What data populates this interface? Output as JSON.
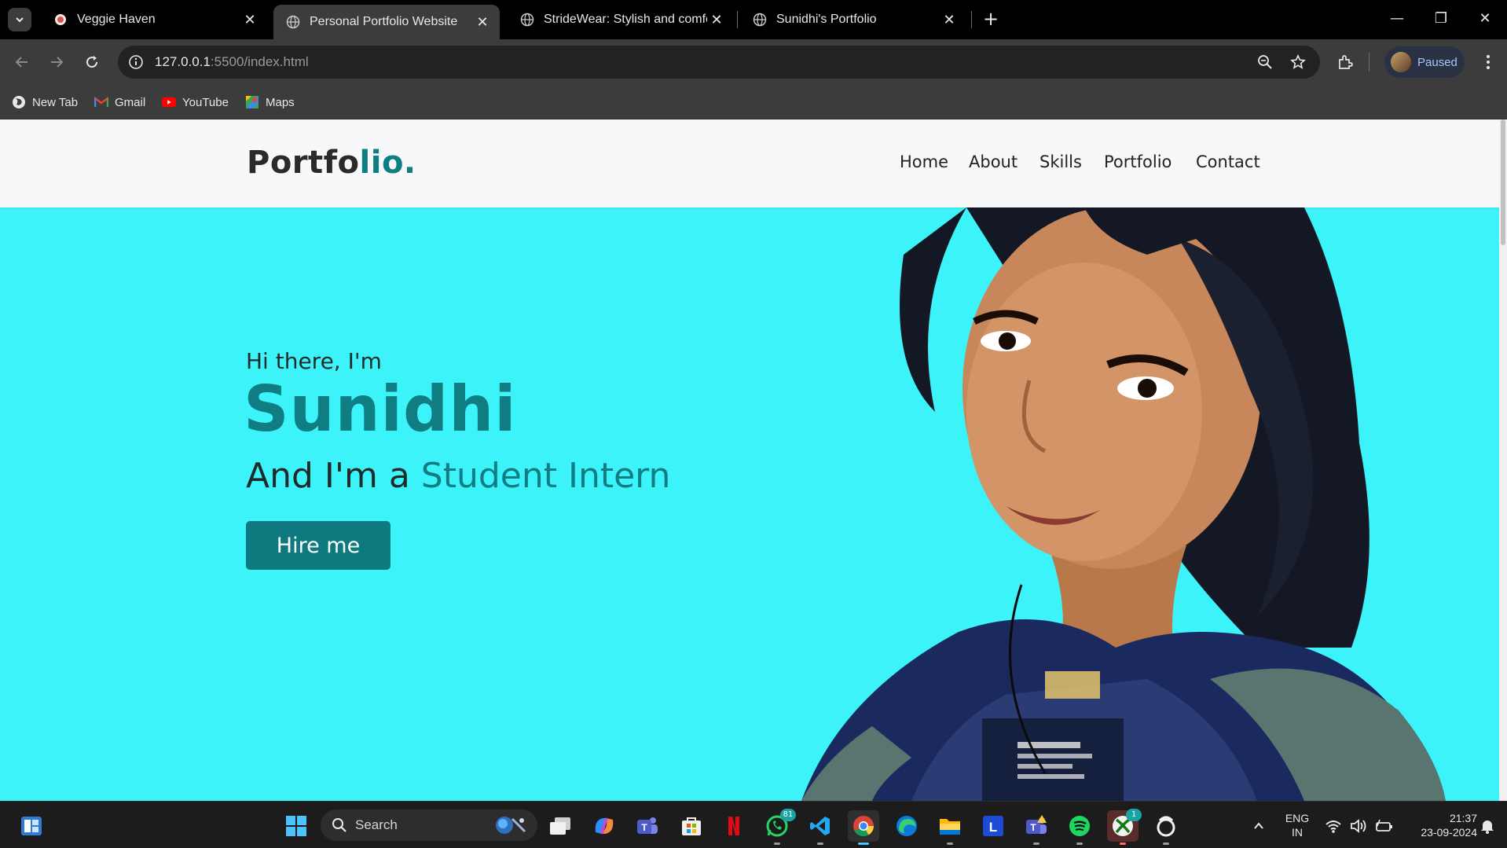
{
  "browser": {
    "tabs": [
      {
        "title": "Veggie Haven",
        "active": false
      },
      {
        "title": "Personal Portfolio Website",
        "active": true
      },
      {
        "title": "StrideWear: Stylish and comfort",
        "active": false
      },
      {
        "title": "Sunidhi's Portfolio",
        "active": false
      }
    ],
    "url_host": "127.0.0.1",
    "url_rest": ":5500/index.html",
    "profile_status": "Paused",
    "bookmarks": [
      {
        "label": "New Tab",
        "icon": "globe-icon"
      },
      {
        "label": "Gmail",
        "icon": "gmail-icon"
      },
      {
        "label": "YouTube",
        "icon": "youtube-icon"
      },
      {
        "label": "Maps",
        "icon": "maps-icon"
      }
    ]
  },
  "site": {
    "logo_main": "Portfo",
    "logo_accent": "lio.",
    "menu": [
      "Home",
      "About",
      "Skills",
      "Portfolio",
      "Contact"
    ],
    "hero": {
      "greeting": "Hi there, I'm",
      "name": "Sunidhi",
      "role_prefix": "And I'm a ",
      "role_accent": "Student Intern",
      "button": "Hire me"
    },
    "colors": {
      "hero_bg": "#3df3fa",
      "accent": "#0f7d82",
      "nav_bg": "#f7f8fa"
    }
  },
  "taskbar": {
    "search_label": "Search",
    "whatsapp_badge": "81",
    "xbox_badge": "1",
    "lang_line1": "ENG",
    "lang_line2": "IN",
    "time": "21:37",
    "date": "23-09-2024",
    "apps": [
      "widgets-icon",
      "start-icon",
      "search-icon",
      "task-view-icon",
      "copilot-icon",
      "teams-icon",
      "store-icon",
      "netflix-icon",
      "whatsapp-icon",
      "vscode-icon",
      "chrome-icon",
      "edge-icon",
      "file-explorer-icon",
      "l-app-icon",
      "teams-work-icon",
      "spotify-icon",
      "xbox-icon",
      "camera-app-icon"
    ]
  }
}
